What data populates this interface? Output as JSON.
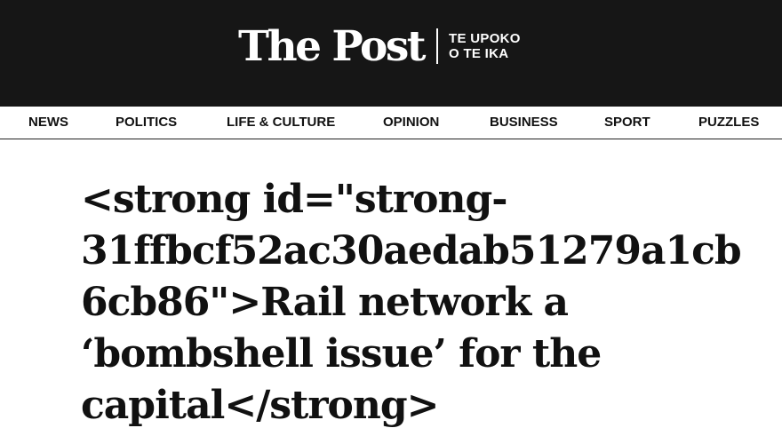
{
  "masthead": {
    "logo_text": "The Post",
    "tagline_line1": "TE UPOKO",
    "tagline_line2": "O TE IKA"
  },
  "nav": {
    "items": [
      {
        "label": "NEWS"
      },
      {
        "label": "POLITICS"
      },
      {
        "label": "LIFE & CULTURE"
      },
      {
        "label": "OPINION"
      },
      {
        "label": "BUSINESS"
      },
      {
        "label": "SPORT"
      },
      {
        "label": "PUZZLES"
      }
    ]
  },
  "article": {
    "headline_lines": [
      "<strong id=\"strong-",
      "31ffbcf52ac30aedab51279a1cb",
      "6cb86\">Rail network a",
      "‘bombshell issue’ for the",
      "capital</strong>"
    ]
  },
  "colors": {
    "masthead_bg": "#161616",
    "text": "#111111",
    "background": "#ffffff"
  }
}
